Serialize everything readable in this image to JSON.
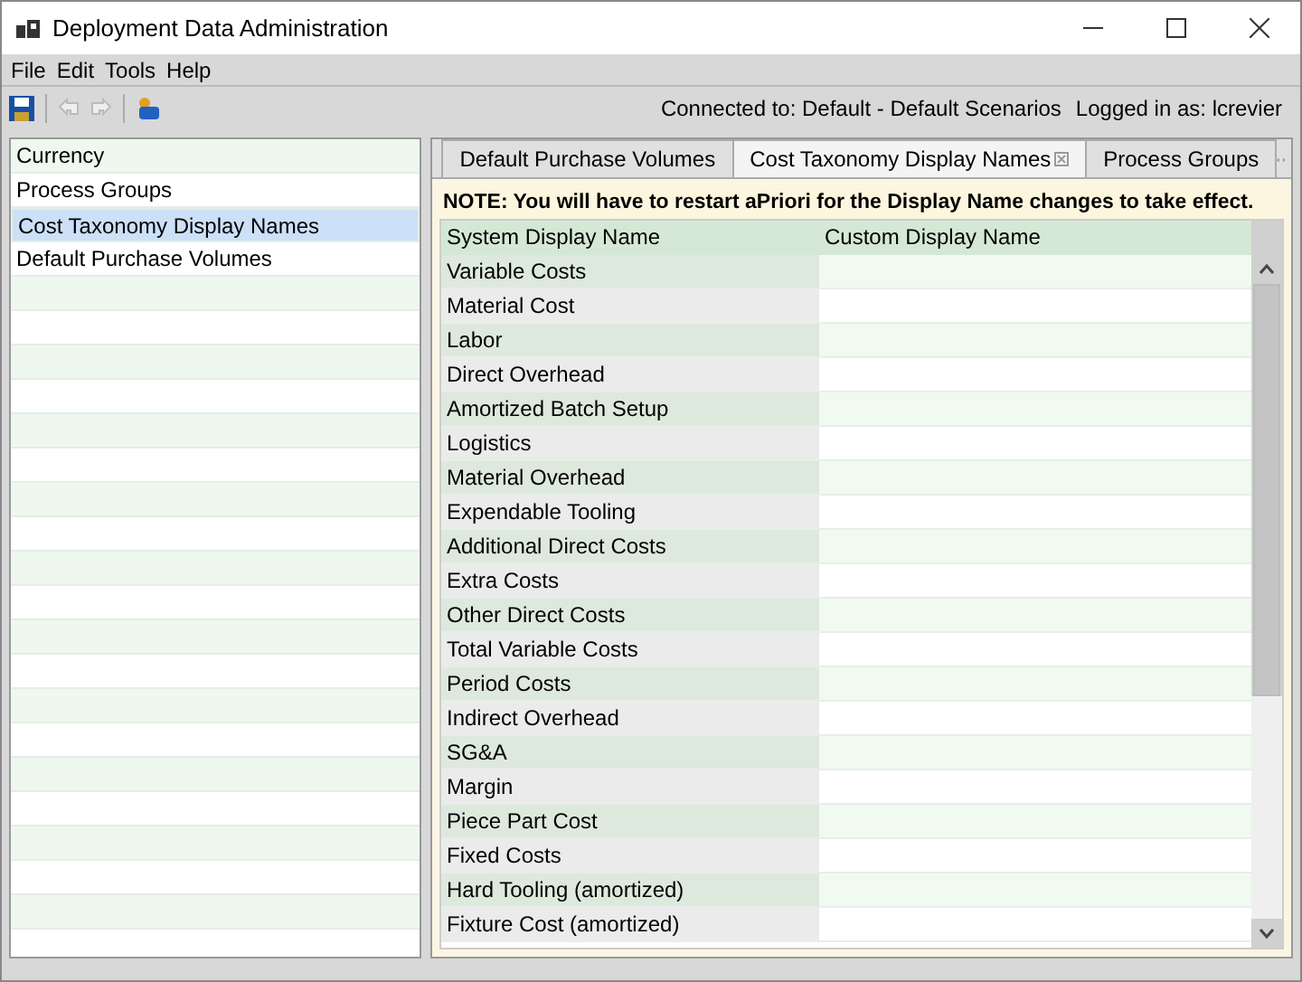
{
  "window": {
    "title": "Deployment Data Administration"
  },
  "menu": [
    "File",
    "Edit",
    "Tools",
    "Help"
  ],
  "status": {
    "connection": "Connected to: Default - Default Scenarios",
    "user": "Logged in as: lcrevier"
  },
  "sidebar": {
    "items": [
      {
        "label": "Currency",
        "selected": false
      },
      {
        "label": "Process Groups",
        "selected": false
      },
      {
        "label": "Cost Taxonomy Display Names",
        "selected": true
      },
      {
        "label": "Default Purchase Volumes",
        "selected": false
      }
    ]
  },
  "tabs": [
    {
      "label": "Default Purchase Volumes",
      "selected": false,
      "closable": false
    },
    {
      "label": "Cost Taxonomy Display Names",
      "selected": true,
      "closable": true
    },
    {
      "label": "Process Groups",
      "selected": false,
      "closable": false
    }
  ],
  "note": "NOTE: You will have to restart aPriori for the Display Name changes to take effect.",
  "table": {
    "columns": [
      "System Display Name",
      "Custom Display Name"
    ],
    "rows": [
      [
        "Variable Costs"
      ],
      [
        "Material Cost"
      ],
      [
        "Labor"
      ],
      [
        "Direct Overhead"
      ],
      [
        "Amortized Batch Setup"
      ],
      [
        "Logistics"
      ],
      [
        "Material Overhead"
      ],
      [
        "Expendable Tooling"
      ],
      [
        "Additional Direct Costs"
      ],
      [
        "Extra Costs"
      ],
      [
        "Other Direct Costs"
      ],
      [
        "Total Variable Costs"
      ],
      [
        "Period Costs"
      ],
      [
        "Indirect Overhead"
      ],
      [
        "SG&A"
      ],
      [
        "Margin"
      ],
      [
        "Piece Part Cost"
      ],
      [
        "Fixed Costs"
      ],
      [
        "Hard Tooling (amortized)"
      ],
      [
        "Fixture Cost (amortized)"
      ]
    ]
  }
}
